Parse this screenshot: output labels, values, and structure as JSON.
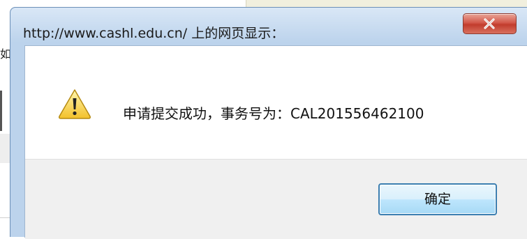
{
  "background": {
    "partial_text": "如"
  },
  "dialog": {
    "title": "http://www.cashl.edu.cn/ 上的网页显示：",
    "close_icon": "close-icon",
    "icon": "warning-icon",
    "message": "申请提交成功，事务号为：CAL201556462100",
    "ok_label": "确定"
  }
}
